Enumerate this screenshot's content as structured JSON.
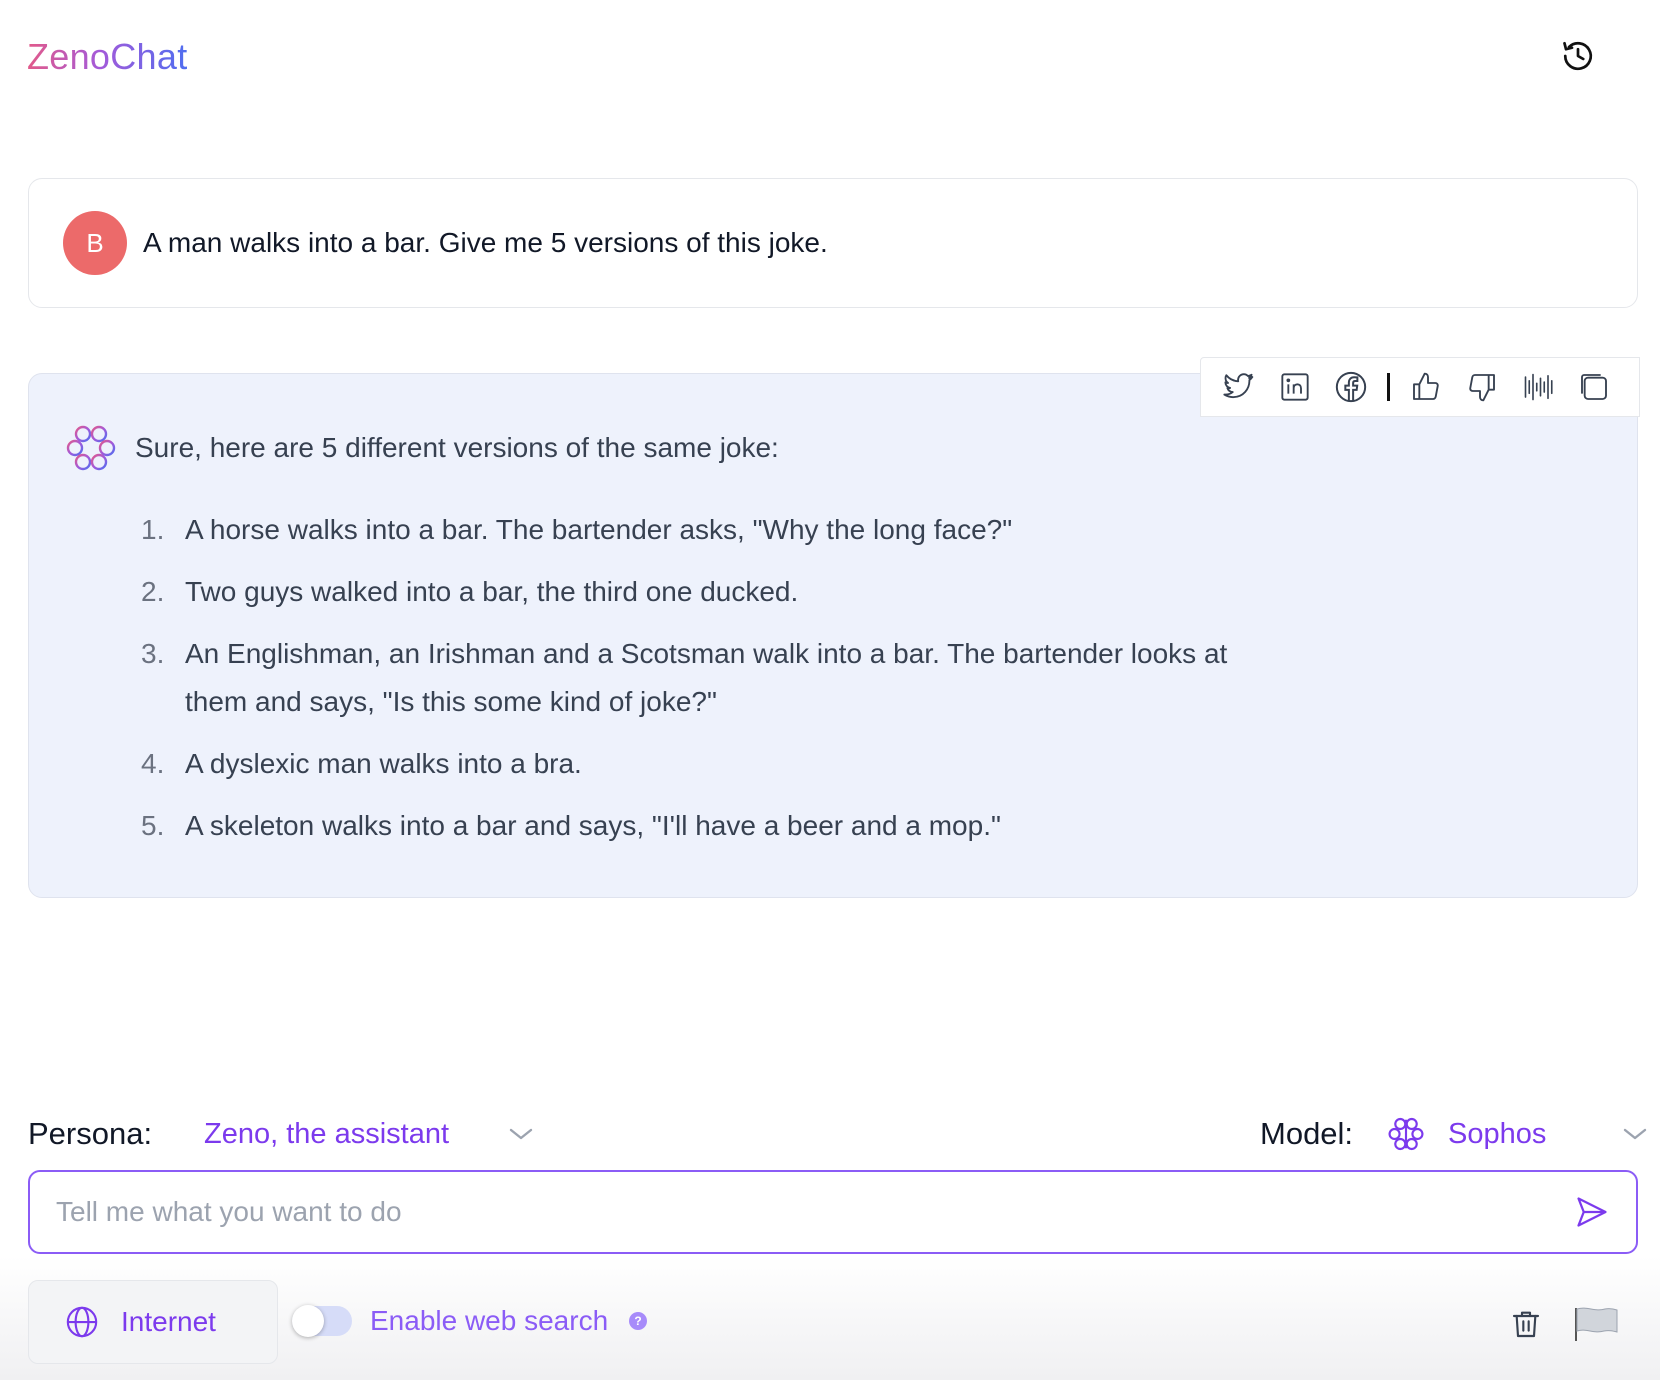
{
  "header": {
    "brand": "ZenoChat",
    "history_icon": "history-icon"
  },
  "conversation": {
    "user_message": {
      "avatar_initial": "B",
      "avatar_color": "#ec6a6a",
      "text": "A man walks into a bar. Give me 5 versions of this joke."
    },
    "assistant_message": {
      "intro": "Sure, here are 5 different versions of the same joke:",
      "items": [
        {
          "num": "1.",
          "text": "A horse walks into a bar. The bartender asks, \"Why the long face?\""
        },
        {
          "num": "2.",
          "text": "Two guys walked into a bar, the third one ducked."
        },
        {
          "num": "3.",
          "text": "An Englishman, an Irishman and a Scotsman walk into a bar. The bartender looks at them and says, \"Is this some kind of joke?\""
        },
        {
          "num": "4.",
          "text": "A dyslexic man walks into a bra."
        },
        {
          "num": "5.",
          "text": "A skeleton walks into a bar and says, \"I'll have a beer and a mop.\""
        }
      ],
      "actions": [
        "twitter-icon",
        "linkedin-icon",
        "facebook-icon",
        "thumbs-up-icon",
        "thumbs-down-icon",
        "audio-waveform-icon",
        "copy-icon"
      ]
    }
  },
  "controls": {
    "persona_label": "Persona:",
    "persona_value": "Zeno, the assistant",
    "model_label": "Model:",
    "model_value": "Sophos",
    "prompt_placeholder": "Tell me what you want to do",
    "internet_label": "Internet",
    "web_search_label": "Enable web search",
    "web_search_enabled": false
  },
  "colors": {
    "accent": "#7c3aed",
    "bot_bg": "#eef2fc",
    "brand_gradient": [
      "#e25a8a",
      "#a45ad9",
      "#4f6ef0"
    ]
  }
}
